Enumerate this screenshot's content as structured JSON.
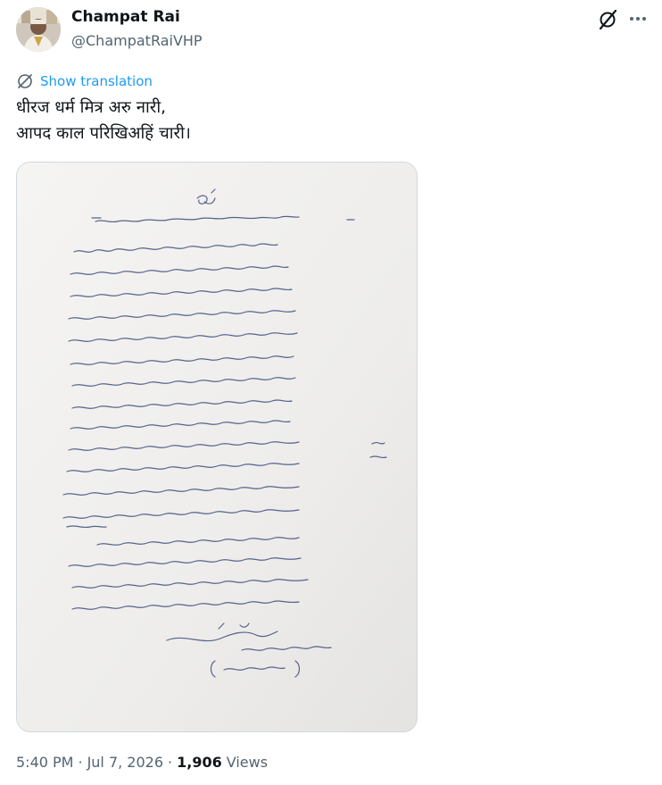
{
  "author": {
    "name": "Champat Rai",
    "handle": "@ChampatRaiVHP"
  },
  "post": {
    "translate_label": "Show translation",
    "lines": [
      "धीरज धर्म मित्र अरु नारी,",
      "आपद काल परिखिअहिं चारी।"
    ]
  },
  "meta": {
    "time": "5:40 PM",
    "date": "Jul 7, 2026",
    "views_count": "1,906",
    "views_label": "Views"
  },
  "icons": {
    "grok": "grok-icon",
    "more": "more-options-icon",
    "translate": "translate-globe-icon"
  },
  "colors": {
    "accent": "#1d9bf0",
    "secondary_text": "#536471",
    "primary_text": "#0f1419",
    "border": "#cfd9de",
    "ink": "#3b4a7a"
  }
}
